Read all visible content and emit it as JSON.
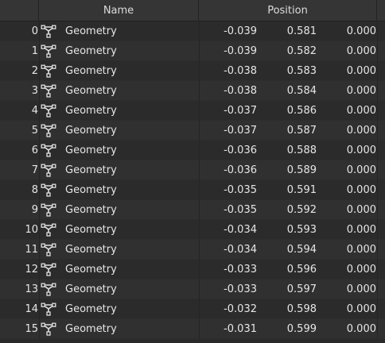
{
  "header": {
    "name_label": "Name",
    "position_label": "Position"
  },
  "icon": "geometry-node-icon",
  "rows": [
    {
      "index": "0",
      "name": "Geometry",
      "x": "-0.039",
      "y": "0.581",
      "z": "0.000"
    },
    {
      "index": "1",
      "name": "Geometry",
      "x": "-0.039",
      "y": "0.582",
      "z": "0.000"
    },
    {
      "index": "2",
      "name": "Geometry",
      "x": "-0.038",
      "y": "0.583",
      "z": "0.000"
    },
    {
      "index": "3",
      "name": "Geometry",
      "x": "-0.038",
      "y": "0.584",
      "z": "0.000"
    },
    {
      "index": "4",
      "name": "Geometry",
      "x": "-0.037",
      "y": "0.586",
      "z": "0.000"
    },
    {
      "index": "5",
      "name": "Geometry",
      "x": "-0.037",
      "y": "0.587",
      "z": "0.000"
    },
    {
      "index": "6",
      "name": "Geometry",
      "x": "-0.036",
      "y": "0.588",
      "z": "0.000"
    },
    {
      "index": "7",
      "name": "Geometry",
      "x": "-0.036",
      "y": "0.589",
      "z": "0.000"
    },
    {
      "index": "8",
      "name": "Geometry",
      "x": "-0.035",
      "y": "0.591",
      "z": "0.000"
    },
    {
      "index": "9",
      "name": "Geometry",
      "x": "-0.035",
      "y": "0.592",
      "z": "0.000"
    },
    {
      "index": "10",
      "name": "Geometry",
      "x": "-0.034",
      "y": "0.593",
      "z": "0.000"
    },
    {
      "index": "11",
      "name": "Geometry",
      "x": "-0.034",
      "y": "0.594",
      "z": "0.000"
    },
    {
      "index": "12",
      "name": "Geometry",
      "x": "-0.033",
      "y": "0.596",
      "z": "0.000"
    },
    {
      "index": "13",
      "name": "Geometry",
      "x": "-0.033",
      "y": "0.597",
      "z": "0.000"
    },
    {
      "index": "14",
      "name": "Geometry",
      "x": "-0.032",
      "y": "0.598",
      "z": "0.000"
    },
    {
      "index": "15",
      "name": "Geometry",
      "x": "-0.031",
      "y": "0.599",
      "z": "0.000"
    }
  ]
}
